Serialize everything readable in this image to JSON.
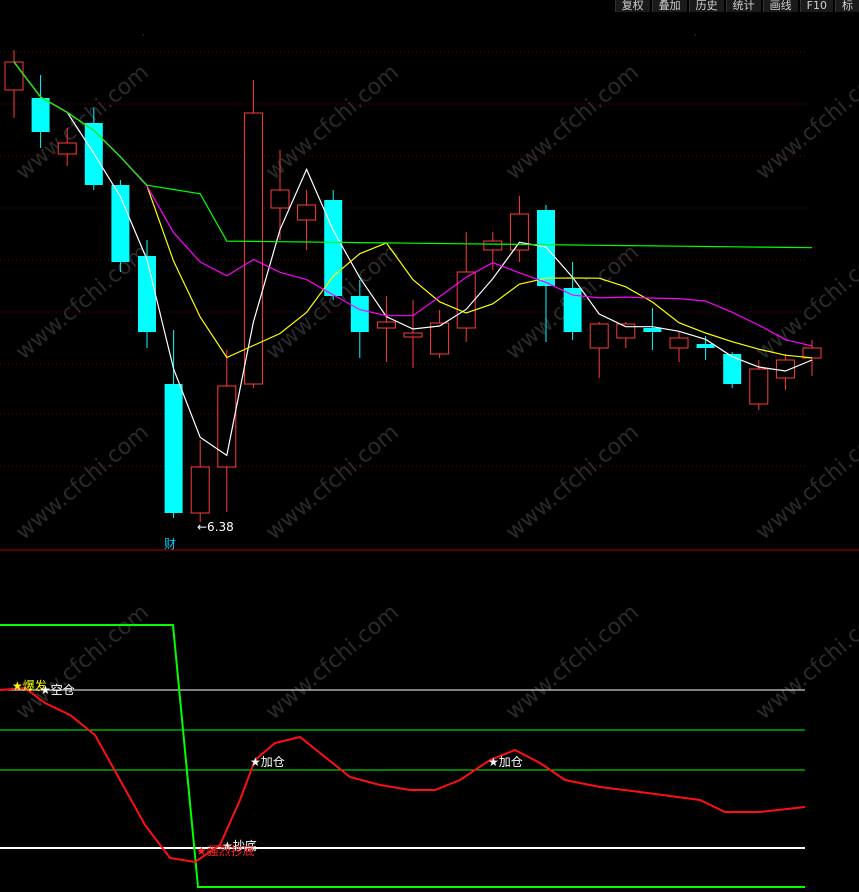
{
  "toolbar": [
    {
      "label": "复权"
    },
    {
      "label": "叠加"
    },
    {
      "label": "历史"
    },
    {
      "label": "统计"
    },
    {
      "label": "画线"
    },
    {
      "label": "F10"
    },
    {
      "label": "标"
    }
  ],
  "watermark": "www.cfchi.com",
  "price_panel": {
    "low_label": "←6.38",
    "fin_marker": "财",
    "candles": [
      {
        "o": 90,
        "c": 62,
        "h": 50,
        "l": 118
      },
      {
        "o": 98,
        "c": 132,
        "h": 75,
        "l": 148
      },
      {
        "o": 154,
        "c": 143,
        "h": 128,
        "l": 166
      },
      {
        "o": 123,
        "c": 185,
        "h": 108,
        "l": 190
      },
      {
        "o": 185,
        "c": 262,
        "h": 180,
        "l": 272
      },
      {
        "o": 256,
        "c": 332,
        "h": 240,
        "l": 348
      },
      {
        "o": 384,
        "c": 513,
        "h": 330,
        "l": 518
      },
      {
        "o": 513,
        "c": 467,
        "h": 440,
        "l": 522
      },
      {
        "o": 467,
        "c": 386,
        "h": 350,
        "l": 512
      },
      {
        "o": 384,
        "c": 113,
        "h": 80,
        "l": 388
      },
      {
        "o": 208,
        "c": 190,
        "h": 150,
        "l": 240
      },
      {
        "o": 220,
        "c": 205,
        "h": 190,
        "l": 250
      },
      {
        "o": 200,
        "c": 296,
        "h": 190,
        "l": 300
      },
      {
        "o": 296,
        "c": 332,
        "h": 280,
        "l": 358
      },
      {
        "o": 328,
        "c": 322,
        "h": 296,
        "l": 362
      },
      {
        "o": 337,
        "c": 333,
        "h": 300,
        "l": 368
      },
      {
        "o": 354,
        "c": 323,
        "h": 310,
        "l": 358
      },
      {
        "o": 328,
        "c": 272,
        "h": 232,
        "l": 342
      },
      {
        "o": 250,
        "c": 241,
        "h": 232,
        "l": 270
      },
      {
        "o": 250,
        "c": 214,
        "h": 196,
        "l": 262
      },
      {
        "o": 210,
        "c": 286,
        "h": 205,
        "l": 342
      },
      {
        "o": 288,
        "c": 332,
        "h": 262,
        "l": 340
      },
      {
        "o": 348,
        "c": 324,
        "h": 322,
        "l": 378
      },
      {
        "o": 338,
        "c": 324,
        "h": 322,
        "l": 348
      },
      {
        "o": 328,
        "c": 332,
        "h": 308,
        "l": 350
      },
      {
        "o": 348,
        "c": 338,
        "h": 332,
        "l": 362
      },
      {
        "o": 344,
        "c": 348,
        "h": 336,
        "l": 360
      },
      {
        "o": 354,
        "c": 384,
        "h": 352,
        "l": 388
      },
      {
        "o": 404,
        "c": 369,
        "h": 360,
        "l": 410
      },
      {
        "o": 378,
        "c": 360,
        "h": 354,
        "l": 390
      },
      {
        "o": 358,
        "c": 348,
        "h": 340,
        "l": 376
      }
    ]
  },
  "indicator_panel": {
    "labels": [
      {
        "text": "★爆发",
        "color": "#ffff00"
      },
      {
        "text": "★空仓",
        "color": "#ffffff"
      },
      {
        "text": "★加仓",
        "color": "#ffffff"
      },
      {
        "text": "★加仓",
        "color": "#ffffff"
      },
      {
        "text": "★抄底",
        "color": "#ffffff"
      },
      {
        "text": "★强烈抄底",
        "color": "#ff2020"
      }
    ]
  }
}
